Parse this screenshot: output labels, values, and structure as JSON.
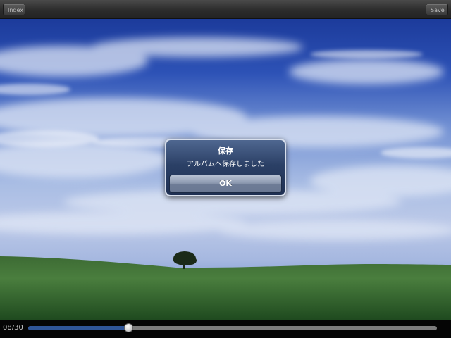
{
  "toolbar": {
    "index_label": "Index",
    "save_label": "Save"
  },
  "alert": {
    "title": "保存",
    "message": "アルバムへ保存しました",
    "ok_label": "OK"
  },
  "slider": {
    "counter": "08/30",
    "progress": 0.245
  },
  "colors": {
    "slider_fill": "#2f5597",
    "alert_bg": "#2b4066"
  }
}
